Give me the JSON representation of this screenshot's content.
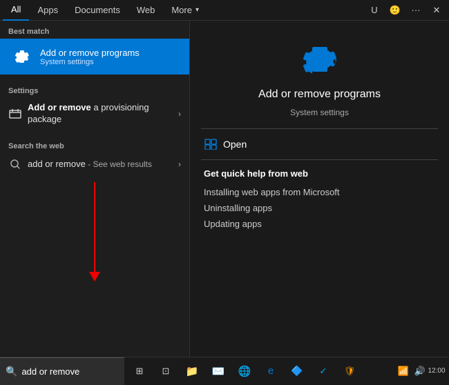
{
  "nav": {
    "items": [
      {
        "label": "All",
        "active": true
      },
      {
        "label": "Apps",
        "active": false
      },
      {
        "label": "Documents",
        "active": false
      },
      {
        "label": "Web",
        "active": false
      },
      {
        "label": "More",
        "active": false
      }
    ],
    "icons": {
      "user": "U",
      "person": "🙂",
      "more": "···",
      "close": "✕"
    }
  },
  "left": {
    "best_match_label": "Best match",
    "best_match_title": "Add or remove programs",
    "best_match_subtitle": "System settings",
    "settings_label": "Settings",
    "settings_item_text_part1": "Add or remove",
    "settings_item_text_part2": " a provisioning",
    "settings_item_text_line2": "package",
    "search_web_label": "Search the web",
    "web_item_text": "add or remove",
    "web_item_suffix": " - See web results"
  },
  "right": {
    "app_title": "Add or remove programs",
    "app_subtitle": "System settings",
    "open_label": "Open",
    "quick_help_title": "Get quick help from web",
    "links": [
      "Installing web apps from Microsoft",
      "Uninstalling apps",
      "Updating apps"
    ]
  },
  "taskbar": {
    "search_text": "add or remove",
    "search_placeholder": "add or remove"
  }
}
